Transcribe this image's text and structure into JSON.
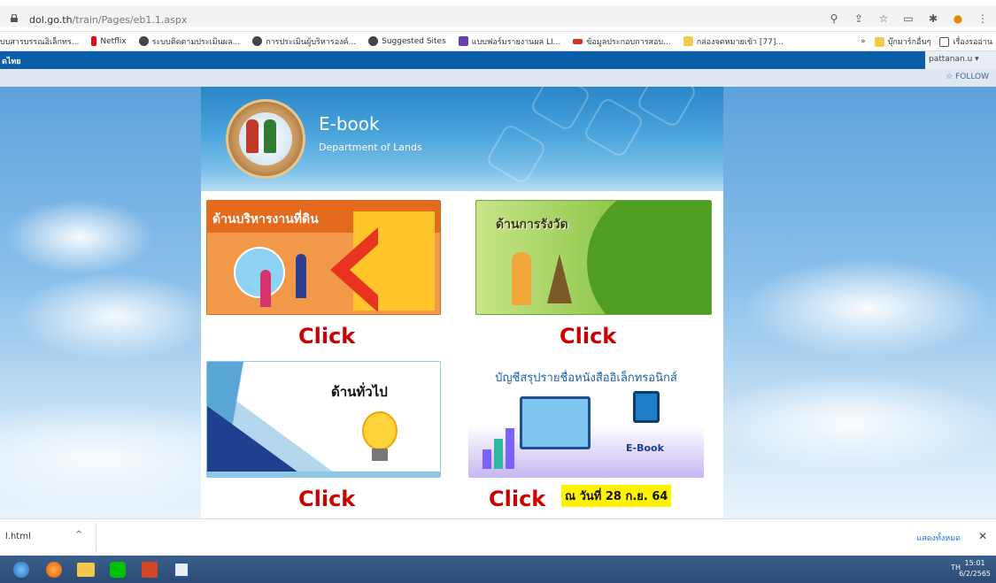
{
  "browser": {
    "url_host": "dol.go.th",
    "url_path": "/train/Pages/eb1.1.aspx"
  },
  "bookmarks": {
    "items": [
      {
        "label": "บบสารบรรณอิเล็กทร...",
        "color": "#ffffff"
      },
      {
        "label": "Netflix",
        "color": "#e50914"
      },
      {
        "label": "ระบบติดตามประเมินผล...",
        "color": "#444444"
      },
      {
        "label": "การประเมินผู้บริหารองค์...",
        "color": "#444444"
      },
      {
        "label": "Suggested Sites",
        "color": "#444444"
      },
      {
        "label": "แบบฟอร์มรายงานผล LI...",
        "color": "#6a3fb5"
      },
      {
        "label": "ข้อมูลประกอบการสอบ...",
        "color": "#d93025"
      },
      {
        "label": "กล่องจดหมายเข้า [77]...",
        "color": "#f2c94c"
      }
    ],
    "overflow": "»",
    "other_bookmarks": "บุ๊กมาร์กอื่นๆ",
    "reading_list": "เรื่องรออ่าน"
  },
  "sharepoint": {
    "left_text": "ดไทย",
    "user": "pattanan.u ▾",
    "follow": "☆ FOLLOW"
  },
  "banner": {
    "title": "E-book",
    "subtitle": "Department of Lands"
  },
  "cards": {
    "land_admin": "ด้านบริหารงานที่ดิน",
    "survey": "ด้านการรังวัด",
    "general": "ด้านทั่วไป",
    "ebook_list": "บัญชีสรุปรายชื่อหนังสืออิเล็กทรอนิกส์",
    "ebook_tag": "E-Book"
  },
  "click_label": "Click",
  "date_badge": "ณ วันที่ 28 ก.ย. 64",
  "downloads": {
    "file": "l.html",
    "caret": "^",
    "show_all": "แสดงทั้งหมด",
    "close": "✕"
  },
  "taskbar": {
    "tray": "TH",
    "time": "15:01",
    "date": "6/2/2565"
  }
}
